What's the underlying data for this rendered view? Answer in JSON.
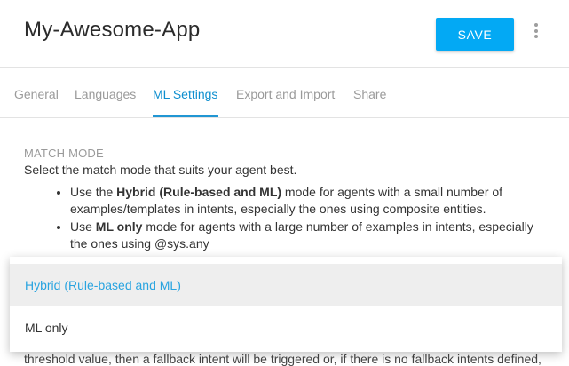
{
  "header": {
    "app_title": "My-Awesome-App",
    "save_label": "SAVE",
    "menu_icon": "more-vert-icon"
  },
  "tabs": [
    {
      "label": "General"
    },
    {
      "label": "Languages"
    },
    {
      "label": "ML Settings",
      "active": true
    },
    {
      "label": "Export and Import"
    },
    {
      "label": "Share"
    }
  ],
  "match_mode": {
    "title": "MATCH MODE",
    "description": "Select the match mode that suits your agent best.",
    "bullet1": {
      "pre": "Use the ",
      "bold": "Hybrid (Rule-based and ML)",
      "post": " mode for agents with a small number of examples/templates in intents, especially the ones using composite entities."
    },
    "bullet2": {
      "pre": "Use ",
      "bold": "ML only",
      "post": " mode for agents with a large number of examples in intents, especially the ones using @sys.any"
    }
  },
  "dropdown": {
    "options": [
      "Hybrid (Rule-based and ML)",
      "ML only"
    ],
    "selected": "Hybrid (Rule-based and ML)"
  },
  "partial_text": "threshold value, then a fallback intent will be triggered or, if there is no fallback intents defined,",
  "colors": {
    "accent": "#03a9f4",
    "active_tab": "#0e8fcf",
    "selected_option": "#29a4e0"
  }
}
